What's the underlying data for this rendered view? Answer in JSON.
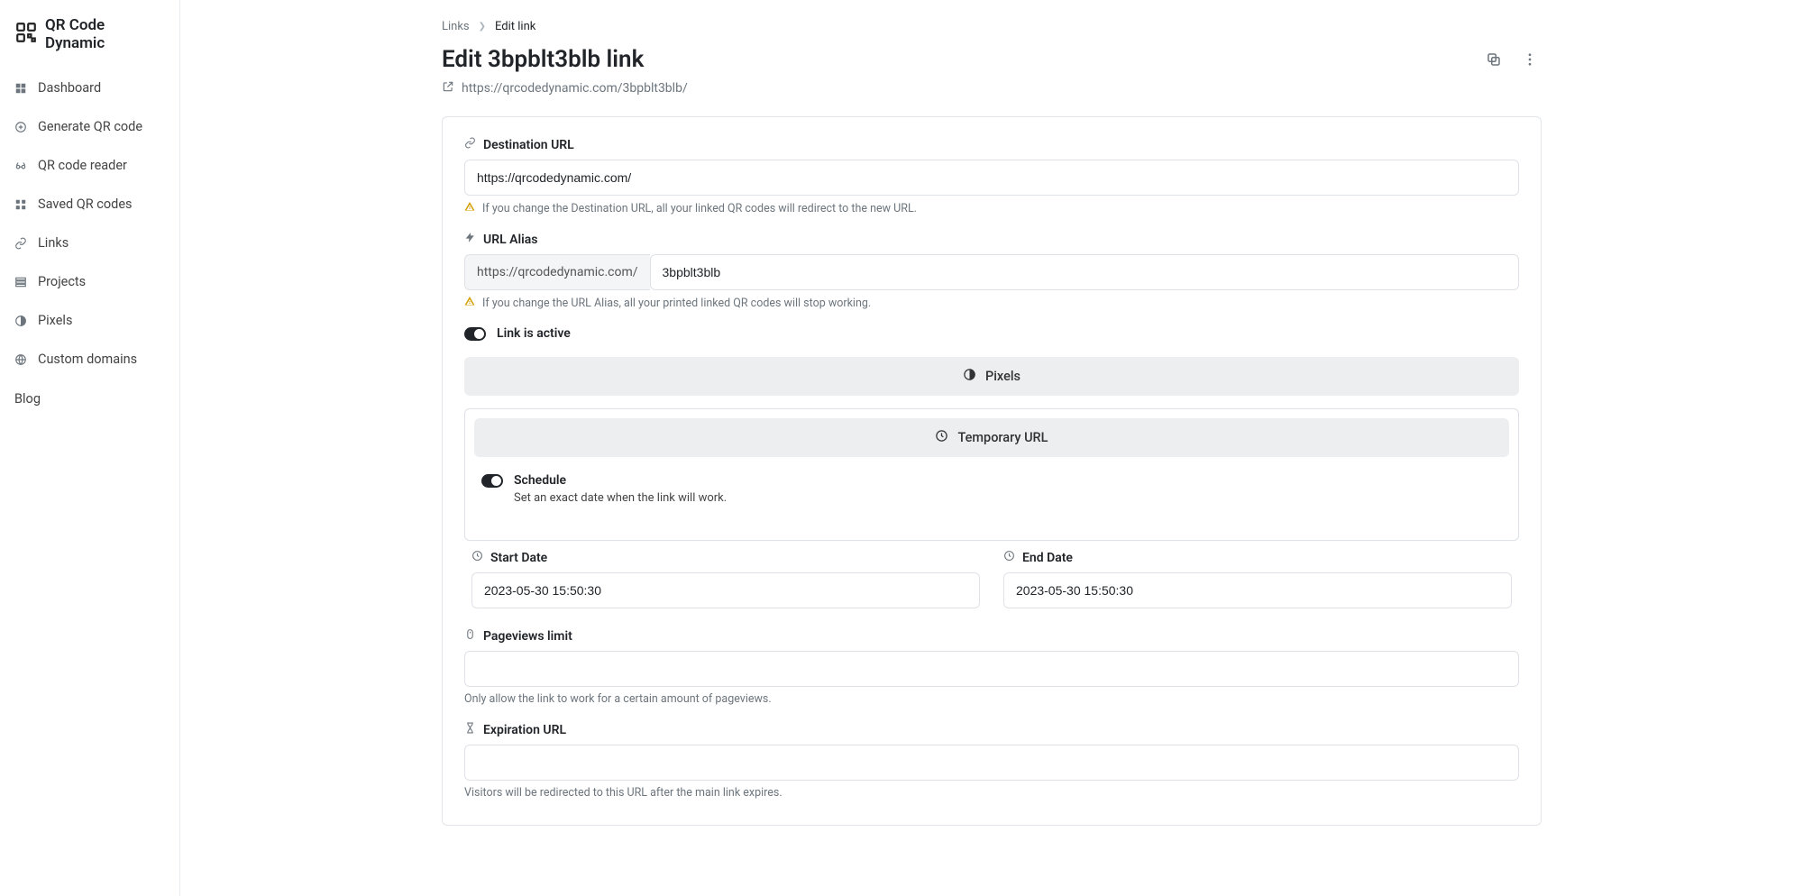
{
  "brand": {
    "name": "QR Code Dynamic"
  },
  "sidebar": {
    "items": [
      {
        "label": "Dashboard",
        "icon": "grid-icon"
      },
      {
        "label": "Generate QR code",
        "icon": "plus-circle-icon"
      },
      {
        "label": "QR code reader",
        "icon": "glasses-icon"
      },
      {
        "label": "Saved QR codes",
        "icon": "apps-icon"
      },
      {
        "label": "Links",
        "icon": "link-icon"
      },
      {
        "label": "Projects",
        "icon": "projects-icon"
      },
      {
        "label": "Pixels",
        "icon": "half-circle-icon"
      },
      {
        "label": "Custom domains",
        "icon": "globe-icon"
      }
    ],
    "blog_label": "Blog"
  },
  "breadcrumb": {
    "link_label": "Links",
    "current_label": "Edit link"
  },
  "header": {
    "title": "Edit 3bpblt3blb link",
    "short_url": "https://qrcodedynamic.com/3bpblt3blb/"
  },
  "form": {
    "destination": {
      "label": "Destination URL",
      "value": "https://qrcodedynamic.com/",
      "warning": "If you change the Destination URL, all your linked QR codes will redirect to the new URL."
    },
    "alias": {
      "label": "URL Alias",
      "prefix": "https://qrcodedynamic.com/",
      "value": "3bpblt3blb",
      "warning": "If you change the URL Alias, all your printed linked QR codes will stop working."
    },
    "active_toggle_label": "Link is active",
    "pixels_section_label": "Pixels",
    "temporary": {
      "section_label": "Temporary URL",
      "schedule_label": "Schedule",
      "schedule_desc": "Set an exact date when the link will work."
    },
    "start_date": {
      "label": "Start Date",
      "value": "2023-05-30 15:50:30"
    },
    "end_date": {
      "label": "End Date",
      "value": "2023-05-30 15:50:30"
    },
    "pageviews": {
      "label": "Pageviews limit",
      "value": "",
      "helper": "Only allow the link to work for a certain amount of pageviews."
    },
    "expiration": {
      "label": "Expiration URL",
      "value": "",
      "helper": "Visitors will be redirected to this URL after the main link expires."
    }
  }
}
